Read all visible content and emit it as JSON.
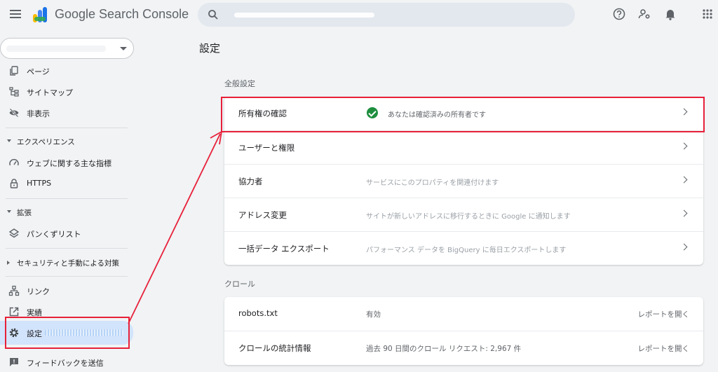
{
  "app": {
    "brand": "Google Search Console"
  },
  "colors": {
    "accent_red": "#e8203a",
    "active_bg": "#d2e3fc",
    "verified_green": "#1e8e3e"
  },
  "sidebar": {
    "items": [
      {
        "label": "ページ",
        "icon": "pages-icon"
      },
      {
        "label": "サイトマップ",
        "icon": "sitemap-icon"
      },
      {
        "label": "非表示",
        "icon": "hidden-icon"
      }
    ],
    "sections": {
      "experience": {
        "label": "エクスペリエンス",
        "items": [
          {
            "label": "ウェブに関する主な指標"
          },
          {
            "label": "HTTPS"
          }
        ]
      },
      "enhancements": {
        "label": "拡張",
        "items": [
          {
            "label": "パンくずリスト"
          }
        ]
      },
      "security": {
        "label": "セキュリティと手動による対策"
      }
    },
    "bottom": [
      {
        "label": "リンク"
      },
      {
        "label": "実績"
      },
      {
        "label": "設定"
      },
      {
        "label": "フィードバックを送信"
      }
    ]
  },
  "main": {
    "title": "設定",
    "general": {
      "title": "全般設定",
      "rows": [
        {
          "name": "所有権の確認",
          "desc": "あなたは確認済みの所有者です"
        },
        {
          "name": "ユーザーと権限",
          "desc": ""
        },
        {
          "name": "協力者",
          "desc": "サービスにこのプロパティを関連付けます"
        },
        {
          "name": "アドレス変更",
          "desc": "サイトが新しいアドレスに移行するときに Google に通知します"
        },
        {
          "name": "一括データ エクスポート",
          "desc": "パフォーマンス データを BigQuery に毎日エクスポートします"
        }
      ]
    },
    "crawl": {
      "title": "クロール",
      "rows": [
        {
          "name": "robots.txt",
          "desc": "有効",
          "action": "レポートを開く"
        },
        {
          "name": "クロールの統計情報",
          "desc": "過去 90 日間のクロール リクエスト: 2,967 件",
          "action": "レポートを開く"
        }
      ]
    }
  }
}
